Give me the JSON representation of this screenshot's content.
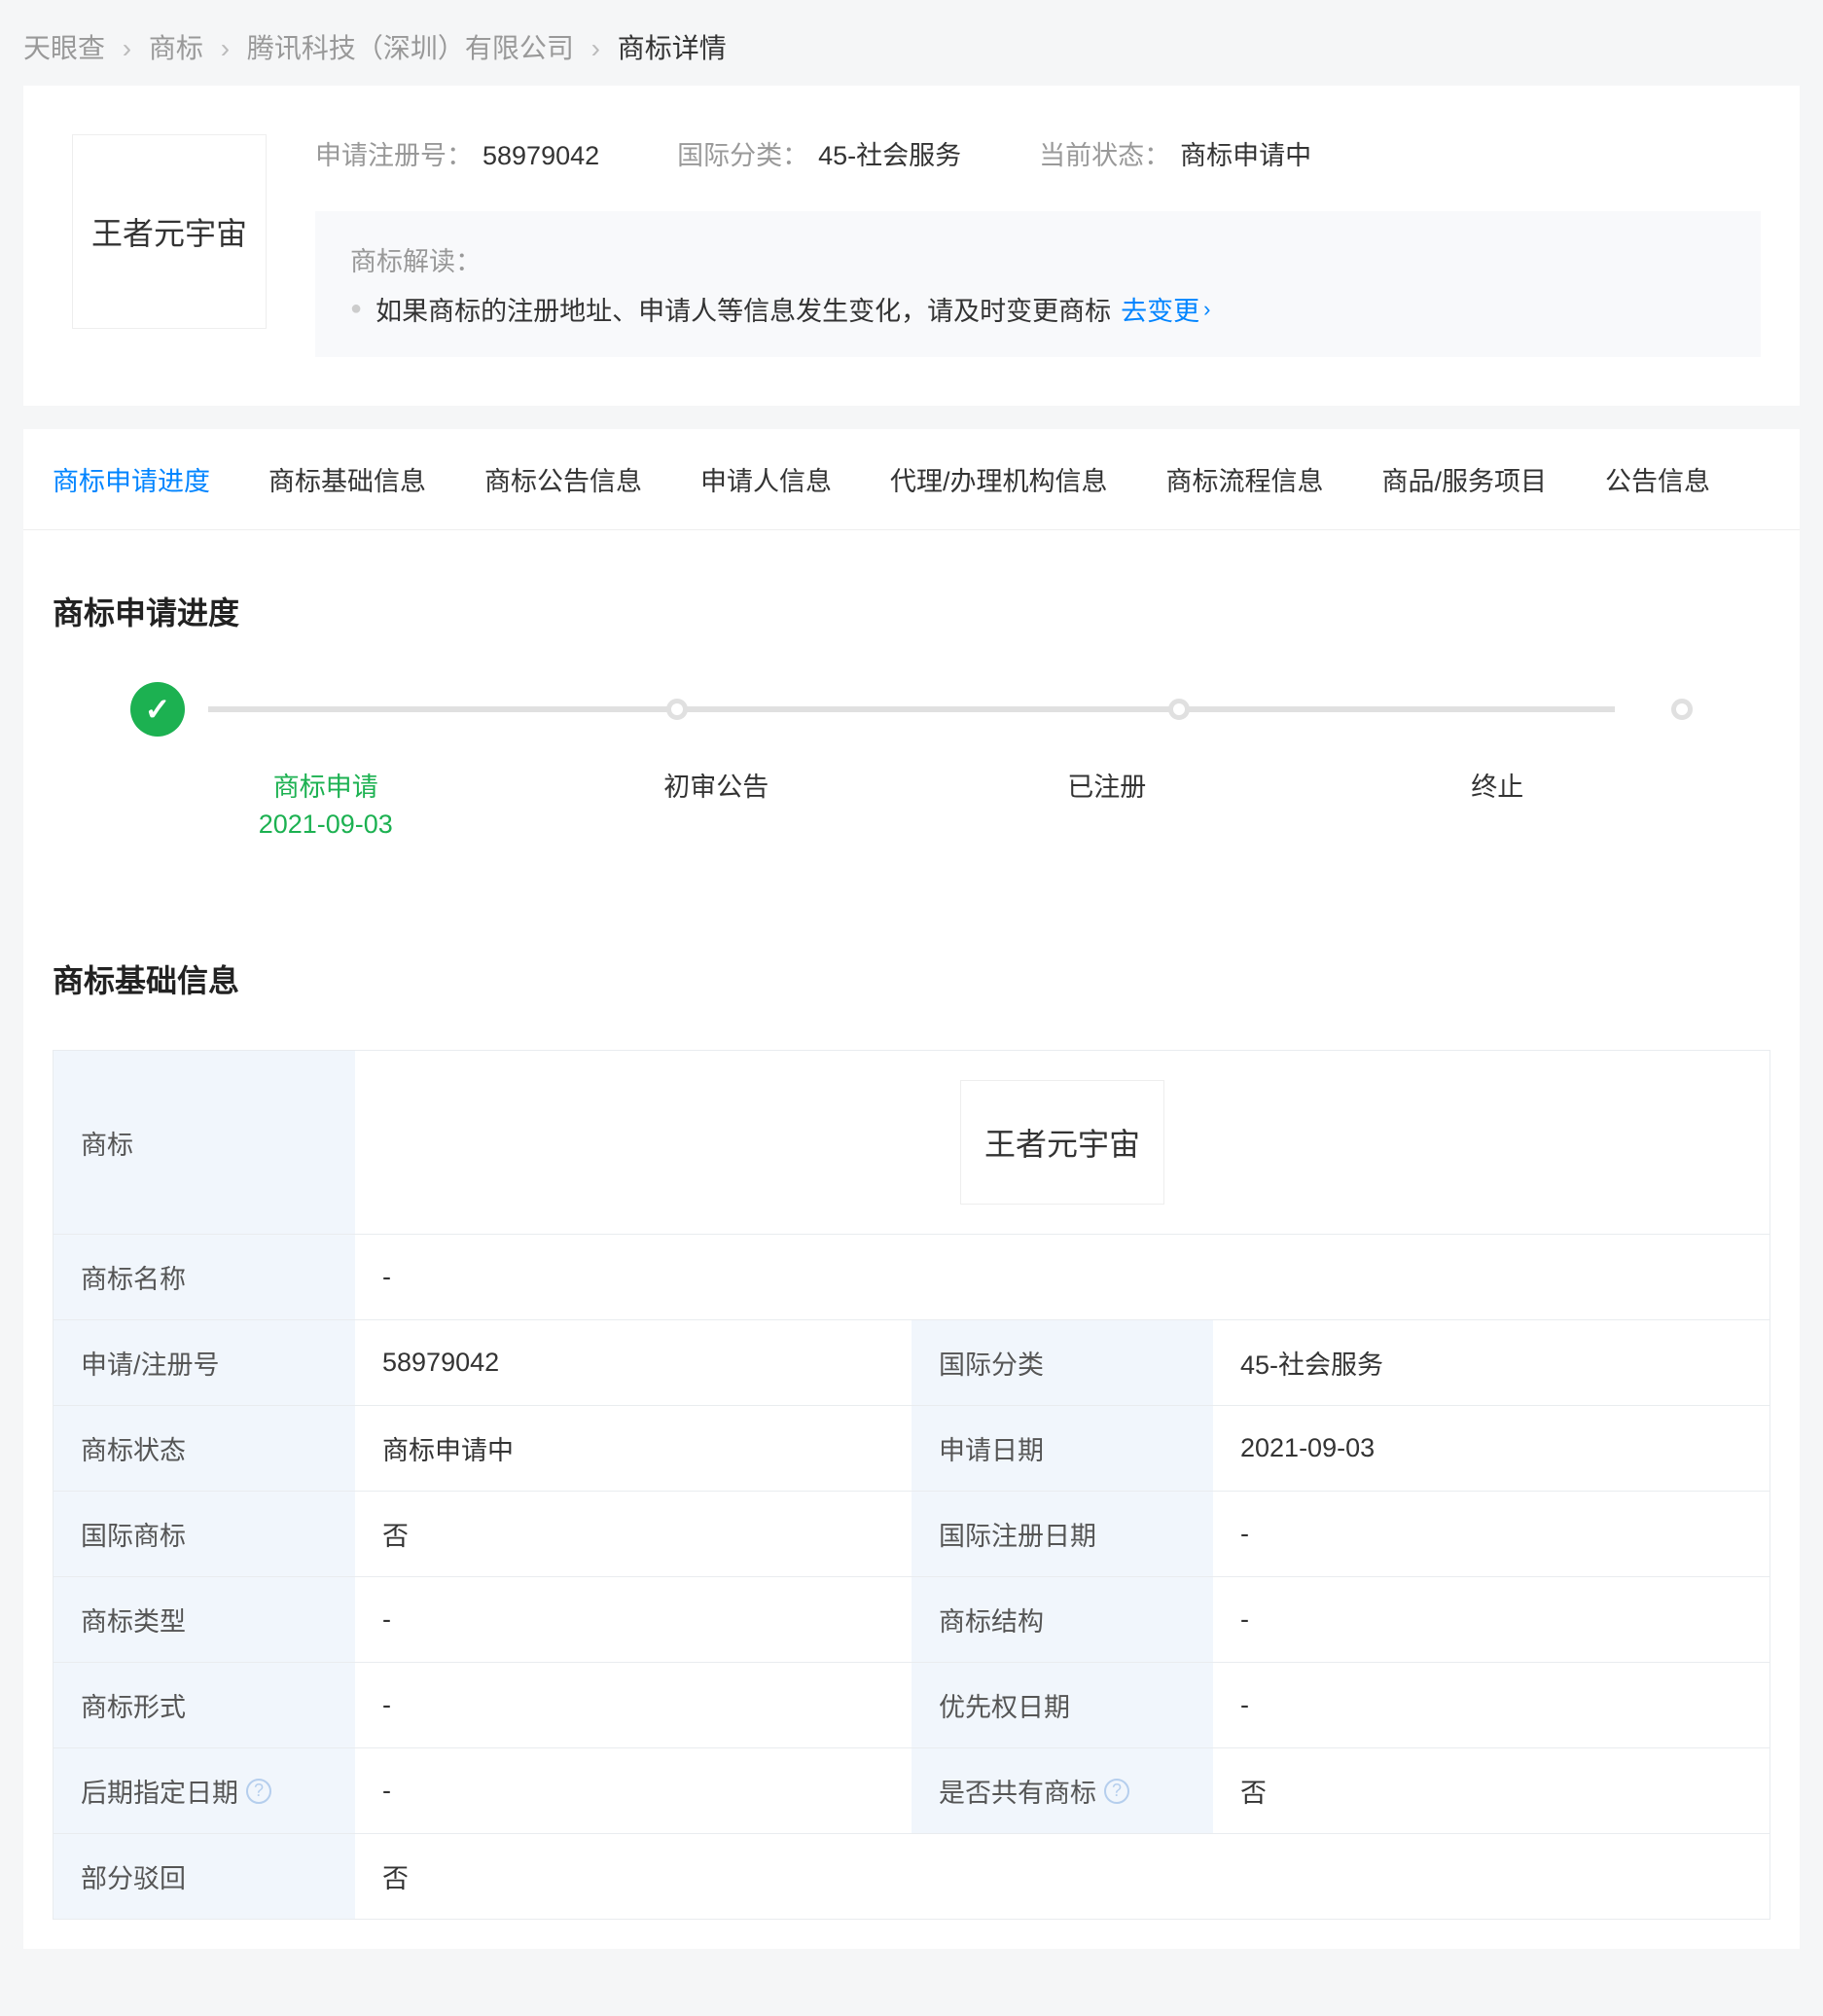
{
  "breadcrumb": {
    "items": [
      "天眼查",
      "商标",
      "腾讯科技（深圳）有限公司"
    ],
    "current": "商标详情"
  },
  "header": {
    "trademark_text": "王者元宇宙",
    "fields": {
      "reg_no_label": "申请注册号：",
      "reg_no": "58979042",
      "class_label": "国际分类：",
      "class": "45-社会服务",
      "status_label": "当前状态：",
      "status": "商标申请中"
    },
    "interpret_title": "商标解读：",
    "interpret_text": "如果商标的注册地址、申请人等信息发生变化，请及时变更商标",
    "change_link": "去变更"
  },
  "tabs": [
    "商标申请进度",
    "商标基础信息",
    "商标公告信息",
    "申请人信息",
    "代理/办理机构信息",
    "商标流程信息",
    "商品/服务项目",
    "公告信息"
  ],
  "progress": {
    "title": "商标申请进度",
    "steps": [
      {
        "label": "商标申请",
        "date": "2021-09-03",
        "done": true
      },
      {
        "label": "初审公告",
        "done": false
      },
      {
        "label": "已注册",
        "done": false
      },
      {
        "label": "终止",
        "done": false
      }
    ]
  },
  "basic": {
    "title": "商标基础信息",
    "trademark_label": "商标",
    "trademark_text": "王者元宇宙",
    "rows": [
      {
        "l1": "商标名称",
        "v1": "-"
      },
      {
        "l1": "申请/注册号",
        "v1": "58979042",
        "l2": "国际分类",
        "v2": "45-社会服务"
      },
      {
        "l1": "商标状态",
        "v1": "商标申请中",
        "l2": "申请日期",
        "v2": "2021-09-03"
      },
      {
        "l1": "国际商标",
        "v1": "否",
        "l2": "国际注册日期",
        "v2": "-"
      },
      {
        "l1": "商标类型",
        "v1": "-",
        "l2": "商标结构",
        "v2": "-"
      },
      {
        "l1": "商标形式",
        "v1": "-",
        "l2": "优先权日期",
        "v2": "-"
      },
      {
        "l1": "后期指定日期",
        "v1": "-",
        "l2": "是否共有商标",
        "v2": "否",
        "help1": true,
        "help2": true
      },
      {
        "l1": "部分驳回",
        "v1": "否"
      }
    ]
  }
}
